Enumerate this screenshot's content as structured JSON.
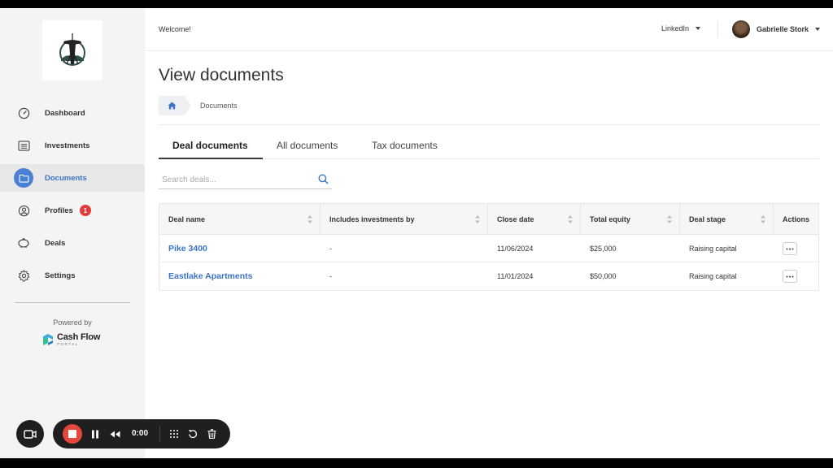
{
  "sidebar": {
    "items": [
      {
        "label": "Dashboard",
        "icon": "dashboard-gauge-icon"
      },
      {
        "label": "Investments",
        "icon": "list-icon"
      },
      {
        "label": "Documents",
        "icon": "folder-icon",
        "active": true
      },
      {
        "label": "Profiles",
        "icon": "user-circle-icon",
        "badge": "1"
      },
      {
        "label": "Deals",
        "icon": "piggy-bank-icon"
      },
      {
        "label": "Settings",
        "icon": "gear-icon"
      }
    ],
    "powered_by": "Powered by",
    "brand_name": "Cash Flow",
    "brand_sub": "PORTAL"
  },
  "header": {
    "welcome": "Welcome!",
    "linkedin": "LinkedIn",
    "user_name": "Gabrielle Stork"
  },
  "main": {
    "title": "View documents",
    "breadcrumb": "Documents",
    "tabs": [
      {
        "label": "Deal documents",
        "active": true
      },
      {
        "label": "All documents"
      },
      {
        "label": "Tax documents"
      }
    ],
    "search_placeholder": "Search deals...",
    "table": {
      "columns": [
        "Deal name",
        "Includes investments by",
        "Close date",
        "Total equity",
        "Deal stage",
        "Actions"
      ],
      "rows": [
        {
          "deal_name": "Pike 3400",
          "includes": "-",
          "close_date": "11/06/2024",
          "total_equity": "$25,000",
          "stage": "Raising capital"
        },
        {
          "deal_name": "Eastlake Apartments",
          "includes": "-",
          "close_date": "11/01/2024",
          "total_equity": "$50,000",
          "stage": "Raising capital"
        }
      ]
    }
  },
  "recorder": {
    "time": "0:00"
  },
  "colors": {
    "accent": "#3b73c8",
    "badge": "#e03c3c",
    "stop": "#e4473c"
  }
}
